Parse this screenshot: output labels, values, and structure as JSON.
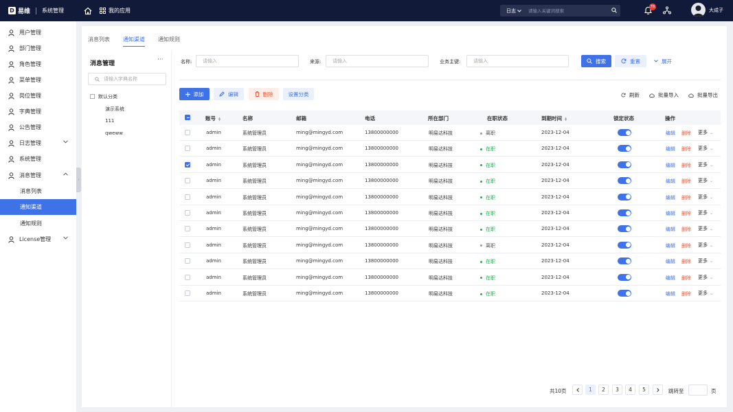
{
  "topbar": {
    "logo_mark": "D",
    "logo_text": "易维",
    "system_title": "系统管理",
    "apps_label": "我的应用",
    "search_type": "日志",
    "search_placeholder": "请输入关键词搜索",
    "notification_count": "76",
    "username": "大成子"
  },
  "sidebar": {
    "items": [
      {
        "label": "用户管理",
        "icon": "user-icon"
      },
      {
        "label": "部门管理",
        "icon": "user-icon"
      },
      {
        "label": "角色管理",
        "icon": "user-icon"
      },
      {
        "label": "菜单管理",
        "icon": "user-icon"
      },
      {
        "label": "岗位管理",
        "icon": "user-icon"
      },
      {
        "label": "字典管理",
        "icon": "user-icon"
      },
      {
        "label": "公告管理",
        "icon": "user-icon"
      },
      {
        "label": "日志管理",
        "icon": "user-icon"
      },
      {
        "label": "系统管理",
        "icon": "user-icon"
      },
      {
        "label": "消息管理",
        "icon": "user-icon"
      },
      {
        "label": "消息列表"
      },
      {
        "label": "通知渠道"
      },
      {
        "label": "通知规则"
      },
      {
        "label": "License管理",
        "icon": "user-icon"
      }
    ]
  },
  "tabs": [
    "消息列表",
    "通知渠道",
    "通知规则"
  ],
  "tree": {
    "title": "消息管理",
    "more": "···",
    "search_placeholder": "请输入字典名称",
    "root": "默认分类",
    "children": [
      "演示系统",
      "111",
      "qweww"
    ]
  },
  "filters": {
    "name_label": "名称:",
    "name_placeholder": "请输入",
    "source_label": "来源:",
    "source_placeholder": "请输入",
    "key_label": "业务主键:",
    "key_placeholder": "请输入",
    "search_btn": "搜索",
    "reset_btn": "重置",
    "expand_btn": "展开"
  },
  "actions": {
    "add": "添加",
    "edit": "编辑",
    "delete": "删除",
    "category": "设置分类",
    "refresh": "刷新",
    "import": "批量导入",
    "export": "批量导出"
  },
  "table": {
    "headers": [
      "账号",
      "名称",
      "邮箱",
      "电话",
      "所在部门",
      "在职状态",
      "到期时间",
      "锁定状态",
      "操作"
    ],
    "rows": [
      {
        "account": "admin",
        "name": "系统管理员",
        "email": "ming@mingyd.com",
        "phone": "13800000000",
        "dept": "明易达科技",
        "status": "离职",
        "active": false,
        "expire": "2023-12-04",
        "checked": false
      },
      {
        "account": "admin",
        "name": "系统管理员",
        "email": "ming@mingyd.com",
        "phone": "13800000000",
        "dept": "明易达科技",
        "status": "在职",
        "active": true,
        "expire": "2023-12-04",
        "checked": false
      },
      {
        "account": "admin",
        "name": "系统管理员",
        "email": "ming@mingyd.com",
        "phone": "13800000000",
        "dept": "明易达科技",
        "status": "在职",
        "active": true,
        "expire": "2023-12-04",
        "checked": true
      },
      {
        "account": "admin",
        "name": "系统管理员",
        "email": "ming@mingyd.com",
        "phone": "13800000000",
        "dept": "明易达科技",
        "status": "在职",
        "active": true,
        "expire": "2023-12-04",
        "checked": false
      },
      {
        "account": "admin",
        "name": "系统管理员",
        "email": "ming@mingyd.com",
        "phone": "13800000000",
        "dept": "明易达科技",
        "status": "在职",
        "active": true,
        "expire": "2023-12-04",
        "checked": false
      },
      {
        "account": "admin",
        "name": "系统管理员",
        "email": "ming@mingyd.com",
        "phone": "13800000000",
        "dept": "明易达科技",
        "status": "在职",
        "active": true,
        "expire": "2023-12-04",
        "checked": false
      },
      {
        "account": "admin",
        "name": "系统管理员",
        "email": "ming@mingyd.com",
        "phone": "13800000000",
        "dept": "明易达科技",
        "status": "在职",
        "active": true,
        "expire": "2023-12-04",
        "checked": false
      },
      {
        "account": "admin",
        "name": "系统管理员",
        "email": "ming@mingyd.com",
        "phone": "13800000000",
        "dept": "明易达科技",
        "status": "离职",
        "active": false,
        "expire": "2023-12-04",
        "checked": false
      },
      {
        "account": "admin",
        "name": "系统管理员",
        "email": "ming@mingyd.com",
        "phone": "13800000000",
        "dept": "明易达科技",
        "status": "在职",
        "active": true,
        "expire": "2023-12-04",
        "checked": false
      },
      {
        "account": "admin",
        "name": "系统管理员",
        "email": "ming@mingyd.com",
        "phone": "13800000000",
        "dept": "明易达科技",
        "status": "在职",
        "active": true,
        "expire": "2023-12-04",
        "checked": false
      },
      {
        "account": "admin",
        "name": "系统管理员",
        "email": "ming@mingyd.com",
        "phone": "13800000000",
        "dept": "明易达科技",
        "status": "在职",
        "active": true,
        "expire": "2023-12-04",
        "checked": false
      }
    ],
    "op_edit": "编辑",
    "op_delete": "删除",
    "op_more": "更多"
  },
  "pagination": {
    "total": "共10页",
    "pages": [
      "1",
      "2",
      "3",
      "4",
      "5"
    ],
    "current": "1",
    "jump_label": "跳转至",
    "jump_unit": "页"
  },
  "colors": {
    "accent": "#3f72e8",
    "topbar": "#111a38",
    "active_status": "#1bb04e",
    "danger": "#e5532f"
  }
}
